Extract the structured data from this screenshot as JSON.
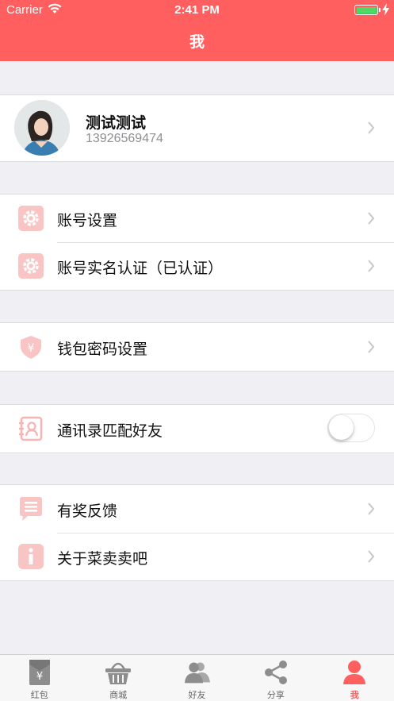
{
  "status_bar": {
    "carrier": "Carrier",
    "time": "2:41 PM"
  },
  "header": {
    "title": "我"
  },
  "profile": {
    "name": "测试测试",
    "phone": "13926569474"
  },
  "account": {
    "items": [
      {
        "label": "账号设置",
        "icon": "gear-icon"
      },
      {
        "label": "账号实名认证（已认证）",
        "icon": "gear-icon"
      }
    ]
  },
  "wallet": {
    "items": [
      {
        "label": "钱包密码设置",
        "icon": "shield-yuan-icon"
      }
    ]
  },
  "contacts": {
    "label": "通讯录匹配好友",
    "toggle_on": false
  },
  "misc": {
    "items": [
      {
        "label": "有奖反馈",
        "icon": "feedback-icon"
      },
      {
        "label": "关于菜卖卖吧",
        "icon": "info-icon"
      }
    ]
  },
  "tabbar": {
    "tabs": [
      {
        "label": "红包",
        "icon": "red-packet-icon"
      },
      {
        "label": "商城",
        "icon": "basket-icon"
      },
      {
        "label": "好友",
        "icon": "friends-icon"
      },
      {
        "label": "分享",
        "icon": "share-icon"
      },
      {
        "label": "我",
        "icon": "person-icon",
        "active": true
      }
    ]
  },
  "colors": {
    "accent": "#ff5f5f",
    "icon_tint": "#f8c4c4",
    "background": "#efeff4"
  }
}
